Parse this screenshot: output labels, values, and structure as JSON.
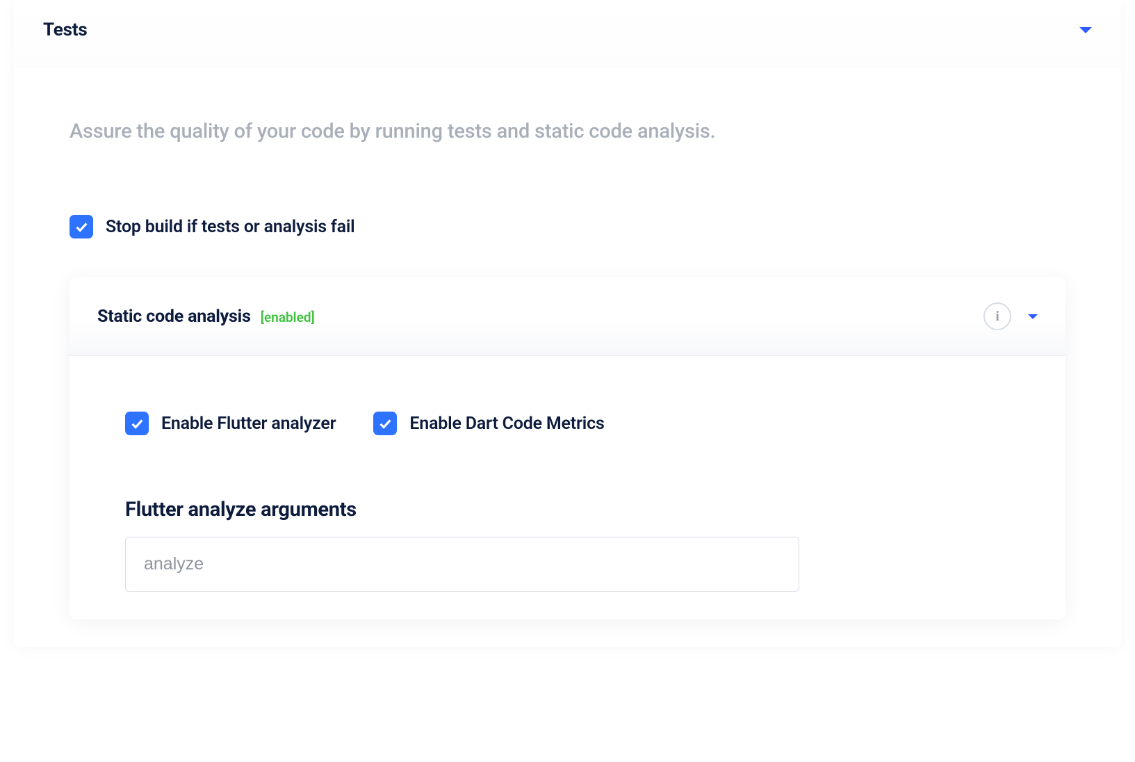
{
  "section": {
    "title": "Tests",
    "description": "Assure the quality of your code by running tests and static code analysis.",
    "stop_on_fail_label": "Stop build if tests or analysis fail",
    "stop_on_fail_checked": true
  },
  "static_analysis": {
    "title": "Static code analysis",
    "status_label": "[enabled]",
    "enable_flutter_analyzer_label": "Enable Flutter analyzer",
    "enable_flutter_analyzer_checked": true,
    "enable_dart_code_metrics_label": "Enable Dart Code Metrics",
    "enable_dart_code_metrics_checked": true,
    "args_field_label": "Flutter analyze arguments",
    "args_value": "analyze"
  },
  "colors": {
    "accent": "#2d5bff",
    "checkbox": "#2d73ff",
    "success": "#3ec23e"
  }
}
